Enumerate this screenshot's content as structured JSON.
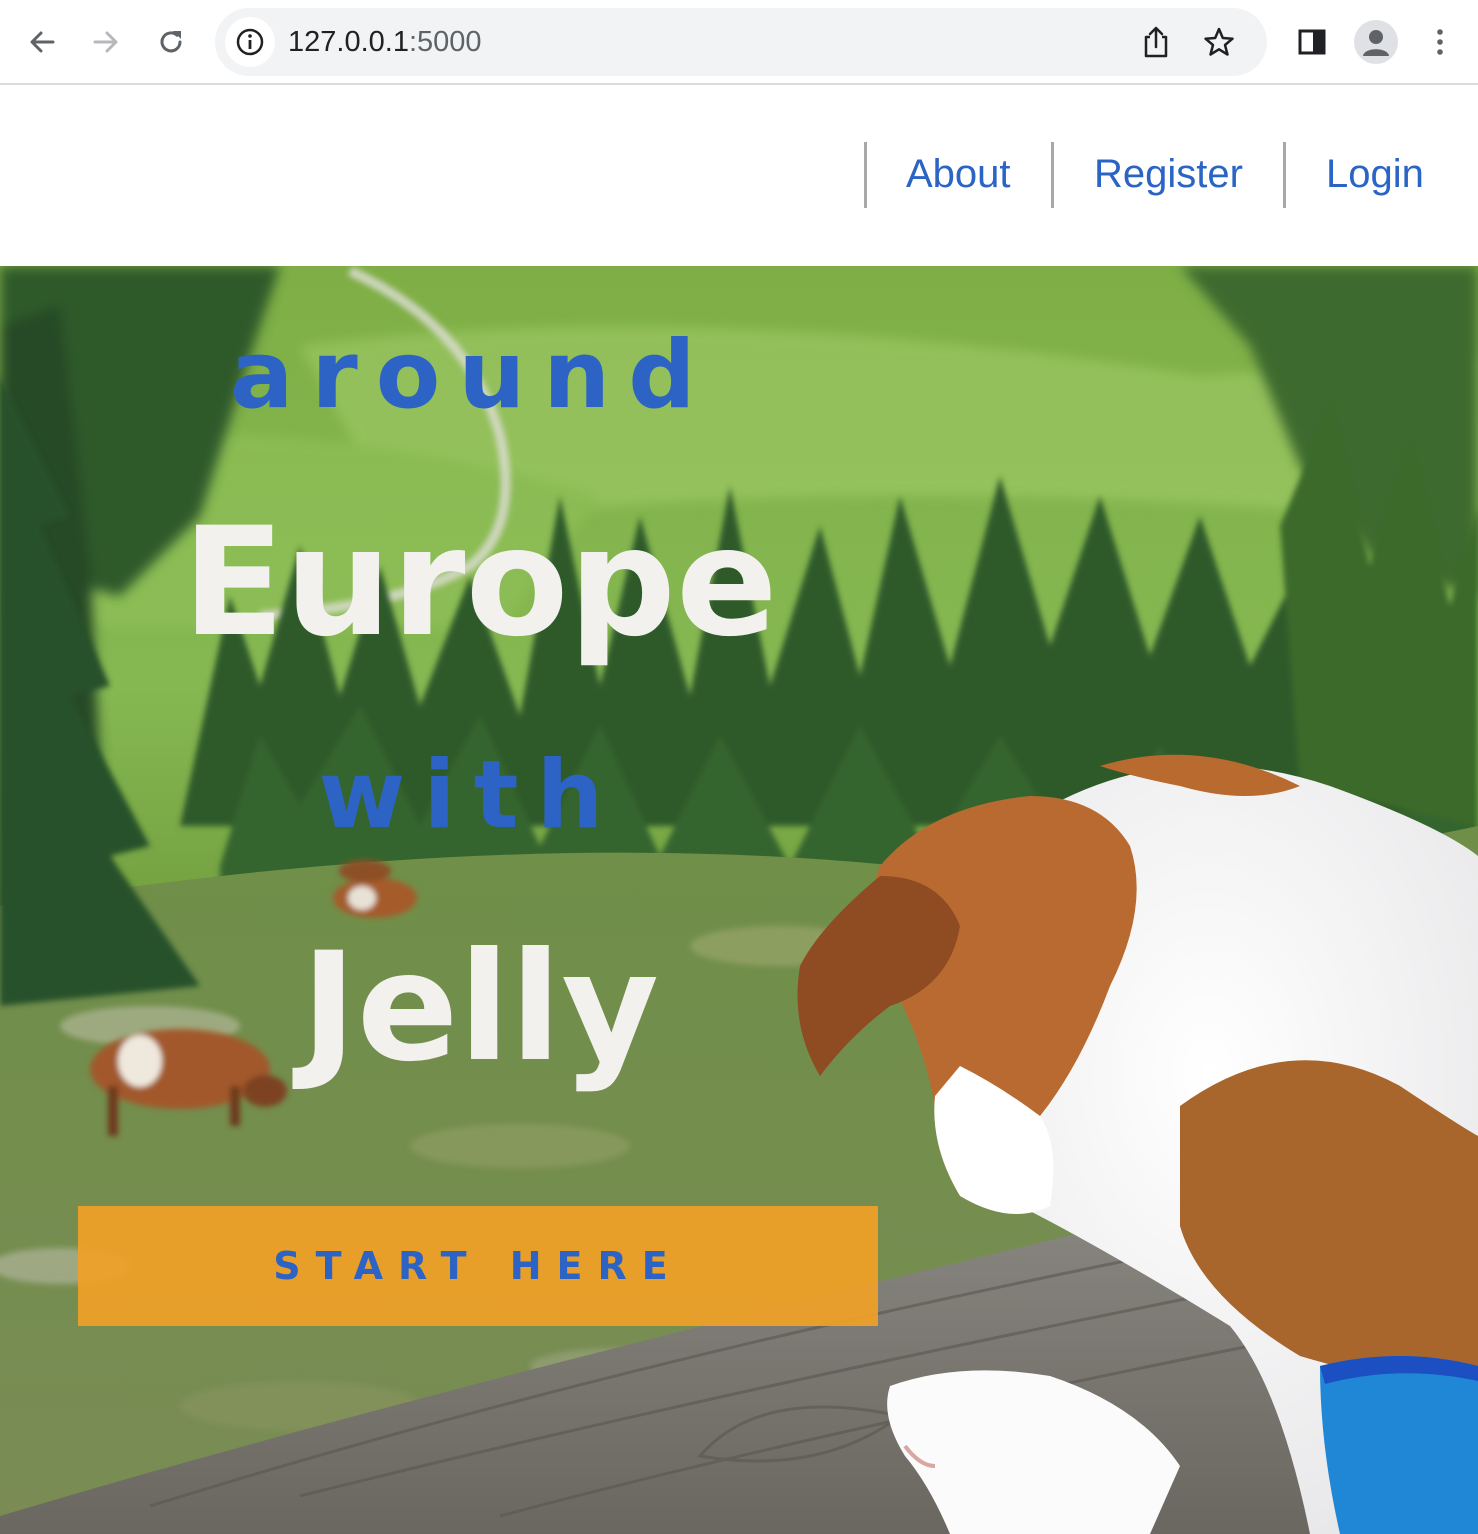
{
  "browser": {
    "url_host": "127.0.0.1",
    "url_port": ":5000"
  },
  "nav": {
    "links": [
      {
        "label": "About"
      },
      {
        "label": "Register"
      },
      {
        "label": "Login"
      }
    ]
  },
  "hero": {
    "line1": "around",
    "line2": "Europe",
    "line3": "with",
    "line4": "Jelly",
    "cta_label": "START HERE"
  },
  "colors": {
    "link_blue": "#2a64c5",
    "accent_blue": "#2d63c4",
    "cta_orange": "#f0a028",
    "hero_text_white": "#f2f1ee"
  },
  "icons": {
    "back": "arrow-left",
    "forward": "arrow-right",
    "reload": "reload",
    "site_info": "info",
    "share": "share",
    "bookmark": "star",
    "side_panel": "side-panel",
    "profile": "person",
    "menu": "kebab-menu"
  }
}
